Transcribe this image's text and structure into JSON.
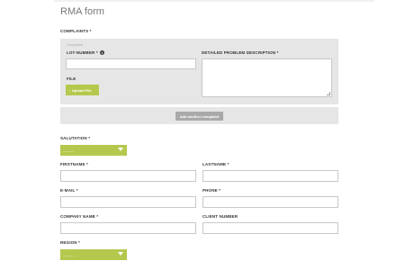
{
  "page": {
    "title": "RMA form"
  },
  "complaints": {
    "section_label": "COMPLAINTS *",
    "complaint_small_label": "Complaint",
    "lot_number_label": "LOT-NUMBER *",
    "info_icon": "info-icon",
    "problem_label": "DETAILED PROBLEM DESCRIPTION *",
    "file_label": "FILE",
    "upload_button": "Upload File",
    "add_button": "Add another complaint"
  },
  "form": {
    "salutation_label": "SALUTATION *",
    "salutation_value": "---------",
    "firstname_label": "FIRSTNAME *",
    "lastname_label": "LASTNAME *",
    "email_label": "E-MAIL *",
    "phone_label": "PHONE *",
    "company_label": "COMPANY NAME *",
    "client_number_label": "CLIENT NUMBER",
    "region_label": "REGION *",
    "region_value": "---------"
  },
  "colors": {
    "accent": "#b5c84d",
    "panel": "#e6e6e6",
    "button_gray": "#a9a9a9"
  }
}
